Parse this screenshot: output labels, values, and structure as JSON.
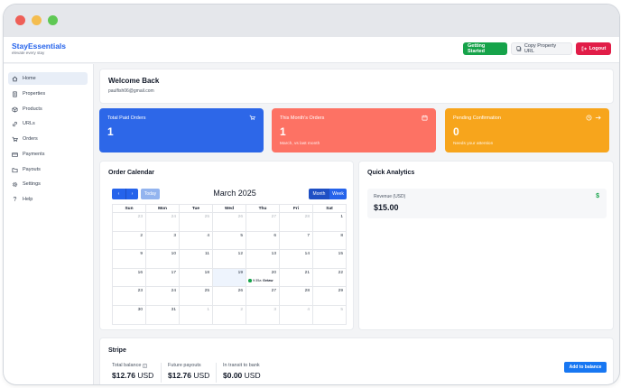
{
  "brand": {
    "name": "StayEssentials",
    "tagline": "elevate every stay"
  },
  "header": {
    "getting_started": "Getting Started",
    "copy_url": "Copy Property URL",
    "logout": "Logout"
  },
  "sidebar": {
    "items": [
      {
        "label": "Home",
        "icon": "home-icon",
        "active": true
      },
      {
        "label": "Properties",
        "icon": "building-icon"
      },
      {
        "label": "Products",
        "icon": "box-icon"
      },
      {
        "label": "URLs",
        "icon": "link-icon"
      },
      {
        "label": "Orders",
        "icon": "cart-icon"
      },
      {
        "label": "Payments",
        "icon": "credit-card-icon"
      },
      {
        "label": "Payouts",
        "icon": "folder-icon"
      },
      {
        "label": "Settings",
        "icon": "gear-icon"
      },
      {
        "label": "Help",
        "icon": "question-icon"
      }
    ]
  },
  "welcome": {
    "title": "Welcome Back",
    "email": "paulfish06@gmail.com"
  },
  "stats": {
    "paid": {
      "label": "Total Paid Orders",
      "value": "1",
      "color": "#2d67e8"
    },
    "month": {
      "label": "This Month's Orders",
      "value": "1",
      "sub": "March, vs last month",
      "color": "#fd7264"
    },
    "pending": {
      "label": "Pending Confirmation",
      "value": "0",
      "sub": "Needs your attention",
      "color": "#f7a51c"
    }
  },
  "calendar": {
    "title": "Order Calendar",
    "prev": "‹",
    "next": "›",
    "today_label": "Today",
    "month_title": "March 2025",
    "view_month": "Month",
    "view_week": "Week",
    "weekdays": [
      "Sun",
      "Mon",
      "Tue",
      "Wed",
      "Thu",
      "Fri",
      "Sat"
    ],
    "weeks": [
      [
        "23",
        "24",
        "25",
        "26",
        "27",
        "28",
        "1"
      ],
      [
        "2",
        "3",
        "4",
        "5",
        "6",
        "7",
        "8"
      ],
      [
        "9",
        "10",
        "11",
        "12",
        "13",
        "14",
        "15"
      ],
      [
        "16",
        "17",
        "18",
        "19",
        "20",
        "21",
        "22"
      ],
      [
        "23",
        "24",
        "25",
        "26",
        "27",
        "28",
        "29"
      ],
      [
        "30",
        "31",
        "1",
        "2",
        "3",
        "4",
        "5"
      ]
    ],
    "event": {
      "time": "9:35a",
      "title": "Getaw"
    }
  },
  "analytics": {
    "title": "Quick Analytics",
    "revenue_label": "Revenue (USD)",
    "revenue_value": "$15.00",
    "revenue_icon": "$"
  },
  "stripe": {
    "title": "Stripe",
    "total_label": "Total balance",
    "total_amount": "$12.76",
    "total_cur": "USD",
    "future_label": "Future payouts",
    "future_amount": "$12.76",
    "future_cur": "USD",
    "transit_label": "In transit to bank",
    "transit_amount": "$0.00",
    "transit_cur": "USD",
    "add_button": "Add to balance"
  }
}
